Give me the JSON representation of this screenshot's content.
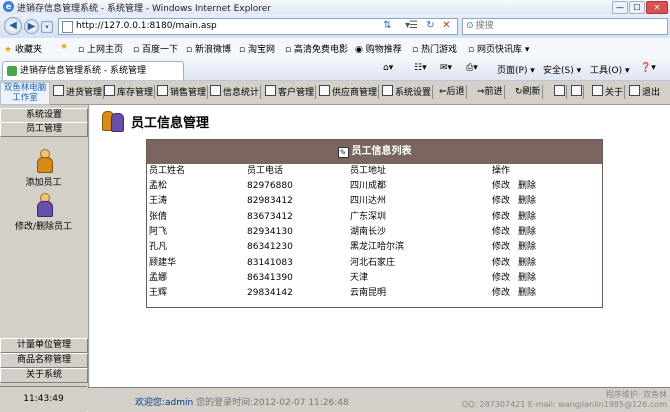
{
  "window": {
    "title": "进销存信息管理系统 - 系统管理 - Windows Internet Explorer",
    "controls": [
      "—",
      "☐",
      "✕"
    ]
  },
  "browser": {
    "address": "http://127.0.0.1:8180/main.asp",
    "search_placeholder": "搜搜",
    "favorites": [
      "收藏夹",
      "上网主页",
      "百度一下",
      "新浪微博",
      "淘宝网",
      "高清免费电影",
      "购物推荐",
      "热门游戏",
      "网页快讯库 ▾"
    ],
    "tab_label": "进销存信息管理系统 - 系统管理",
    "tools": [
      "页面(P) ▾",
      "安全(S) ▾",
      "工具(O) ▾",
      "❓▾"
    ]
  },
  "app": {
    "logo": "双鱼林电脑工作室",
    "toolbar": [
      "进货管理",
      "库存管理",
      "销售管理",
      "信息统计",
      "客户管理",
      "供应商管理",
      "系统设置",
      "后退",
      "前进",
      "刷新",
      "",
      "",
      "关于",
      "退出"
    ]
  },
  "sidebar": {
    "tabs_top": [
      "系统设置",
      "员工管理"
    ],
    "items": [
      "添加员工",
      "修改/删除员工"
    ],
    "tabs_bottom": [
      "计量单位管理",
      "商品名称管理",
      "关于系统"
    ],
    "clock": "11:43:49"
  },
  "page": {
    "title": "员工信息管理",
    "table_title": "员工信息列表",
    "columns": [
      "员工姓名",
      "员工电话",
      "员工地址",
      "操作"
    ],
    "actions": [
      "修改",
      "删除"
    ],
    "rows": [
      [
        "孟松",
        "82976880",
        "四川成都"
      ],
      [
        "王涛",
        "82983412",
        "四川达州"
      ],
      [
        "张倩",
        "83673412",
        "广东深圳"
      ],
      [
        "阿飞",
        "82934130",
        "湖南长沙"
      ],
      [
        "孔凡",
        "86341230",
        "黑龙江哈尔滨"
      ],
      [
        "顾建华",
        "83141083",
        "河北石家庄"
      ],
      [
        "孟娜",
        "86341390",
        "天津"
      ],
      [
        "王辉",
        "29834142",
        "云南昆明"
      ]
    ]
  },
  "status": {
    "welcome": "欢迎您:",
    "user": "admin",
    "login_time": "您的登录时间:2012-02-07 11:26:48",
    "maintainer": "程序维护: 双鱼林",
    "contact": "QQ: 287307421 E-mail: wangjianlin1985@126.com"
  }
}
